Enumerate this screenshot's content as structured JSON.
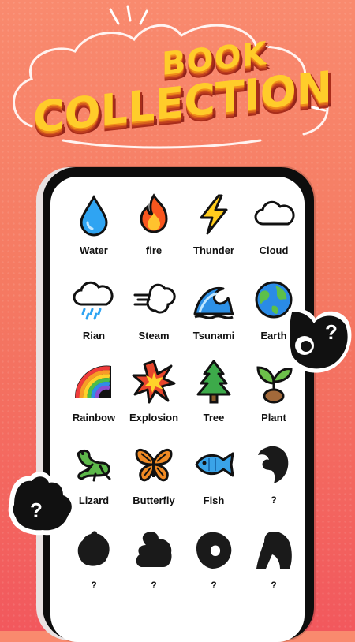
{
  "header": {
    "title_line1": "BOOK",
    "title_line2": "COLLECTION"
  },
  "collection": {
    "items": [
      {
        "label": "Water",
        "icon": "water-drop-icon"
      },
      {
        "label": "fire",
        "icon": "fire-icon"
      },
      {
        "label": "Thunder",
        "icon": "lightning-icon"
      },
      {
        "label": "Cloud",
        "icon": "cloud-icon"
      },
      {
        "label": "Rian",
        "icon": "rain-cloud-icon"
      },
      {
        "label": "Steam",
        "icon": "steam-icon"
      },
      {
        "label": "Tsunami",
        "icon": "wave-icon"
      },
      {
        "label": "Earth",
        "icon": "globe-icon"
      },
      {
        "label": "Rainbow",
        "icon": "rainbow-icon"
      },
      {
        "label": "Explosion",
        "icon": "explosion-icon"
      },
      {
        "label": "Tree",
        "icon": "tree-icon"
      },
      {
        "label": "Plant",
        "icon": "seedling-icon"
      },
      {
        "label": "Lizard",
        "icon": "lizard-icon"
      },
      {
        "label": "Butterfly",
        "icon": "butterfly-icon"
      },
      {
        "label": "Fish",
        "icon": "fish-icon"
      },
      {
        "label": "?",
        "icon": "locked-dolphin-silhouette-icon"
      },
      {
        "label": "?",
        "icon": "locked-turkey-silhouette-icon"
      },
      {
        "label": "?",
        "icon": "locked-turtle-silhouette-icon"
      },
      {
        "label": "?",
        "icon": "locked-snail-silhouette-icon"
      },
      {
        "label": "?",
        "icon": "locked-horse-silhouette-icon"
      }
    ]
  },
  "badges": {
    "right_badge": "?",
    "left_badge": "?"
  },
  "colors": {
    "background_top": "#f98a6e",
    "background_bottom": "#f2585d",
    "title_fill": "#ffcc2a",
    "title_shadow": "#a82d1b",
    "phone_frame": "#0d0d0d"
  }
}
